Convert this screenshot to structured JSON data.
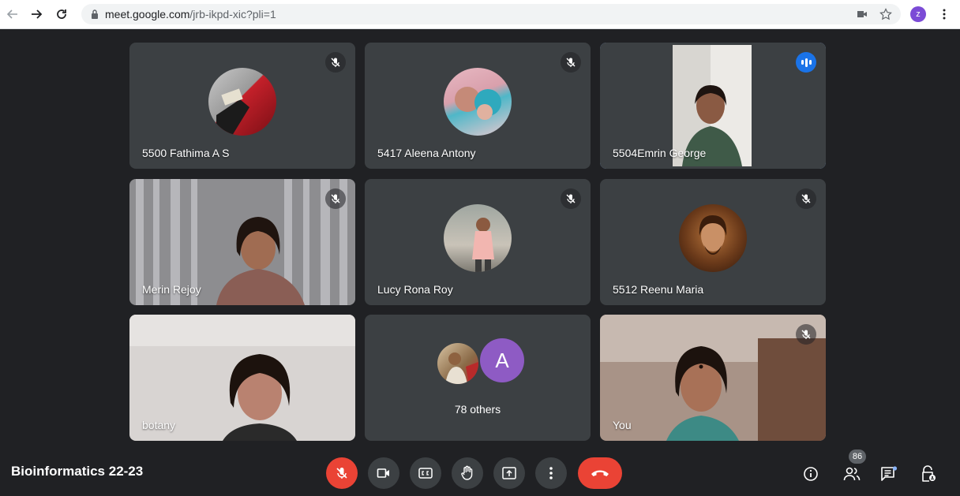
{
  "browser": {
    "url_host": "meet.google.com",
    "url_path": "/jrb-ikpd-xic?pli=1",
    "profile_initial": "z"
  },
  "tiles": [
    {
      "name": "5500 Fathima A S",
      "muted": true
    },
    {
      "name": "5417 Aleena Antony",
      "muted": true
    },
    {
      "name": "5504Emrin George",
      "muted": false,
      "speaking": true
    },
    {
      "name": "Merin Rejoy",
      "muted": true
    },
    {
      "name": "Lucy Rona Roy",
      "muted": true
    },
    {
      "name": "5512 Reenu Maria",
      "muted": true
    },
    {
      "name": "botany",
      "muted": false
    },
    {
      "others_initial": "A",
      "others_label": "78 others"
    },
    {
      "name": "You",
      "muted": true
    }
  ],
  "meeting": {
    "title": "Bioinformatics 22-23",
    "participant_count": "86"
  },
  "colors": {
    "background": "#202124",
    "tile": "#3c4043",
    "speaking_outline": "#8ab4f8",
    "end_call": "#ea4335",
    "accent": "#1a73e8"
  }
}
